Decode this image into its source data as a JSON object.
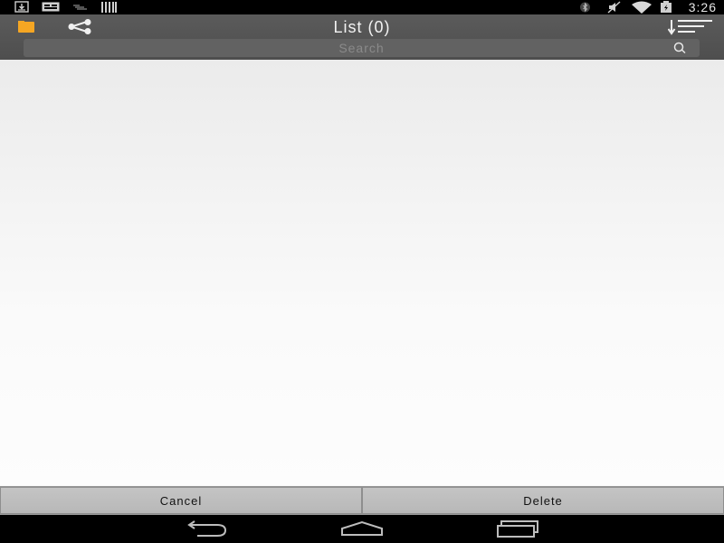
{
  "status_bar": {
    "time": "3:26",
    "left_icons": [
      "download-icon",
      "keyboard-icon",
      "signal-small-icon",
      "barcode-icon"
    ],
    "right_icons": [
      "bluetooth-icon",
      "mute-icon",
      "wifi-icon",
      "battery-icon"
    ]
  },
  "toolbar": {
    "title": "List (0)",
    "folder_icon_color": "#f5a623"
  },
  "search": {
    "placeholder": "Search",
    "value": ""
  },
  "actions": {
    "cancel_label": "Cancel",
    "delete_label": "Delete"
  },
  "nav": [
    "back-icon",
    "home-icon",
    "recents-icon"
  ]
}
